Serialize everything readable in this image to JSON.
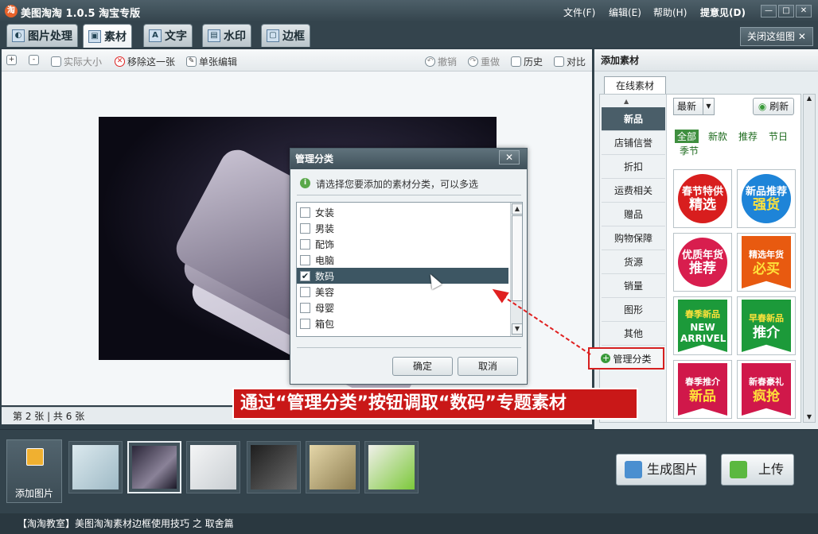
{
  "app": {
    "title": "美图淘淘 1.0.5 淘宝专版",
    "logo": "淘"
  },
  "menu": [
    "文件(F)",
    "编辑(E)",
    "帮助(H)",
    "提意见(D)"
  ],
  "window_controls": {
    "minimize": "—",
    "maximize": "□",
    "close": "✕"
  },
  "tabs": [
    {
      "label": "图片处理",
      "icon": "palette-icon"
    },
    {
      "label": "素材",
      "icon": "sticker-icon"
    },
    {
      "label": "文字",
      "icon": "text-icon"
    },
    {
      "label": "水印",
      "icon": "watermark-icon"
    },
    {
      "label": "边框",
      "icon": "frame-icon"
    }
  ],
  "close_group": "关闭这组图",
  "toolbar": {
    "zoom_in": "+",
    "zoom_out": "-",
    "actual_size": "实际大小",
    "remove": "移除这一张",
    "single_edit": "单张编辑",
    "undo": "撤销",
    "redo": "重做",
    "history": "历史",
    "compare": "对比"
  },
  "status": "第 2 张 | 共 6 张",
  "dialog": {
    "title": "管理分类",
    "close": "✕",
    "info": "请选择您要添加的素材分类，可以多选",
    "items": [
      {
        "label": "女装",
        "checked": false
      },
      {
        "label": "男装",
        "checked": false
      },
      {
        "label": "配饰",
        "checked": false
      },
      {
        "label": "电脑",
        "checked": false
      },
      {
        "label": "数码",
        "checked": true
      },
      {
        "label": "美容",
        "checked": false
      },
      {
        "label": "母婴",
        "checked": false
      },
      {
        "label": "箱包",
        "checked": false
      }
    ],
    "ok": "确定",
    "cancel": "取消"
  },
  "annotation": "通过“管理分类”按钮调取“数码”专题素材",
  "right_panel": {
    "title": "添加素材",
    "tab": "在线素材",
    "categories": [
      "新品",
      "店铺信誉",
      "折扣",
      "运费相关",
      "赠品",
      "购物保障",
      "货源",
      "销量",
      "图形",
      "其他"
    ],
    "manage": "管理分类",
    "sort": "最新",
    "refresh": "刷新",
    "filters": [
      "全部",
      "新款",
      "推荐",
      "节日",
      "季节"
    ],
    "stickers": [
      {
        "line1": "春节特供",
        "line2": "精选",
        "color": "#d81e1e"
      },
      {
        "line1": "新品推荐",
        "line2": "强货",
        "color": "#1e84d8"
      },
      {
        "line1": "优质年货",
        "line2": "推荐",
        "color": "#d81e4e"
      },
      {
        "line1": "精选年货",
        "line2": "必买",
        "color": "#e85a10"
      },
      {
        "line1": "春季新品",
        "line2": "NEW ARRIVEL",
        "color": "#1c9a3a"
      },
      {
        "line1": "早春新品",
        "line2": "推介",
        "color": "#1c9a3a"
      },
      {
        "line1": "春季推介",
        "line2": "新品",
        "color": "#d0184a"
      },
      {
        "line1": "新春豪礼",
        "line2": "疯抢",
        "color": "#d0184a"
      }
    ]
  },
  "bottom": {
    "add_picture": "添加图片",
    "generate": "生成图片",
    "upload": "上传",
    "film_colors": [
      "#b9d2dc",
      "#5d5668",
      "#dfe3e6",
      "#3b3b3b",
      "#c8b98a",
      "#8fd04a"
    ]
  },
  "footer": "【淘淘教室】美图淘淘素材边框使用技巧 之 取舍篇"
}
